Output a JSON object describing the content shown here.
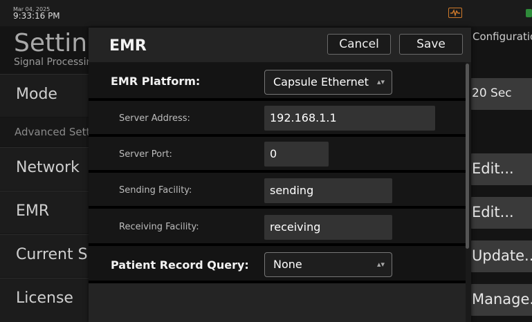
{
  "status": {
    "date": "Mar 04, 2025",
    "time": "9:33:16 PM"
  },
  "background": {
    "title": "Settings",
    "subtitle": "Signal Processing",
    "rows": {
      "mode": "Mode",
      "advanced": "Advanced Settings",
      "network": "Network",
      "emr": "EMR",
      "current": "Current S",
      "license": "License"
    },
    "right": {
      "tab": "Configuration",
      "mode_value": "20 Sec",
      "network_edit": "Edit...",
      "emr_edit": "Edit...",
      "update": "Update...",
      "manage": "Manage..."
    }
  },
  "modal": {
    "title": "EMR",
    "cancel_label": "Cancel",
    "save_label": "Save",
    "platform_label": "EMR Platform:",
    "platform_value": "Capsule Ethernet",
    "server_address_label": "Server Address:",
    "server_address_value": "192.168.1.1",
    "server_port_label": "Server Port:",
    "server_port_value": "0",
    "sending_facility_label": "Sending Facility:",
    "sending_facility_value": "sending",
    "receiving_facility_label": "Receiving Facility:",
    "receiving_facility_value": "receiving",
    "patient_query_label": "Patient Record Query:",
    "patient_query_value": "None"
  },
  "colors": {
    "accent_orange": "#d07a2a",
    "status_green": "#2e8b3a"
  },
  "icons": [
    "waveform-icon",
    "chevron-updown-icon"
  ]
}
